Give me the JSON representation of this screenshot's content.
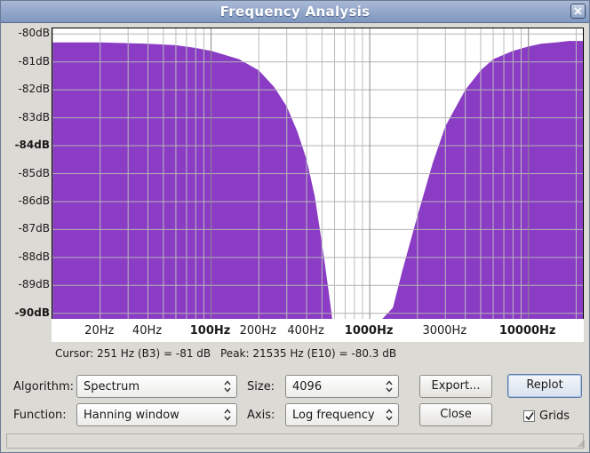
{
  "window": {
    "title": "Frequency Analysis"
  },
  "chart_data": {
    "type": "area",
    "title": "",
    "xlabel": "",
    "ylabel": "",
    "x_scale": "log",
    "grid": true,
    "fill_color": "#8a3cc4",
    "xlim": [
      10,
      22050
    ],
    "ylim": [
      -90.2,
      -79.8
    ],
    "y_ticks": [
      "-80dB",
      "-81dB",
      "-82dB",
      "-83dB",
      "-84dB",
      "-85dB",
      "-86dB",
      "-87dB",
      "-88dB",
      "-89dB",
      "-90dB"
    ],
    "y_tick_values": [
      -80,
      -81,
      -82,
      -83,
      -84,
      -85,
      -86,
      -87,
      -88,
      -89,
      -90
    ],
    "y_bold_ticks": [
      "-84dB",
      "-90dB"
    ],
    "x_ticks": [
      "20Hz",
      "40Hz",
      "100Hz",
      "200Hz",
      "400Hz",
      "1000Hz",
      "3000Hz",
      "10000Hz"
    ],
    "x_tick_values": [
      20,
      40,
      100,
      200,
      400,
      1000,
      3000,
      10000
    ],
    "x_bold_ticks": [
      "100Hz",
      "1000Hz",
      "10000Hz"
    ],
    "series": [
      {
        "x": [
          10,
          20,
          40,
          60,
          80,
          100,
          150,
          200,
          250,
          300,
          350,
          400,
          450,
          500,
          550,
          580,
          600,
          700,
          800,
          900,
          1000,
          1050,
          1200,
          1400,
          1600,
          2000,
          2500,
          3000,
          4000,
          5000,
          6000,
          8000,
          10000,
          12000,
          15000,
          18000,
          22050
        ],
        "y": [
          -80.3,
          -80.3,
          -80.35,
          -80.4,
          -80.5,
          -80.6,
          -80.9,
          -81.3,
          -81.9,
          -82.6,
          -83.5,
          -84.5,
          -85.8,
          -87.5,
          -89.2,
          -90.2,
          -90.2,
          -90.2,
          -90.2,
          -90.2,
          -90.2,
          -90.2,
          -90.2,
          -89.8,
          -88.5,
          -86.5,
          -84.6,
          -83.3,
          -82.0,
          -81.3,
          -80.9,
          -80.6,
          -80.45,
          -80.35,
          -80.3,
          -80.25,
          -80.25
        ]
      }
    ]
  },
  "readout": {
    "cursor": "Cursor: 251 Hz (B3) = -81 dB",
    "peak": "Peak: 21535 Hz (E10) = -80.3 dB"
  },
  "controls": {
    "algorithm_label": "Algorithm:",
    "algorithm_value": "Spectrum",
    "size_label": "Size:",
    "size_value": "4096",
    "function_label": "Function:",
    "function_value": "Hanning window",
    "axis_label": "Axis:",
    "axis_value": "Log frequency",
    "export_label": "Export...",
    "replot_label": "Replot",
    "close_label": "Close",
    "grids_label": "Grids",
    "grids_checked": true
  }
}
